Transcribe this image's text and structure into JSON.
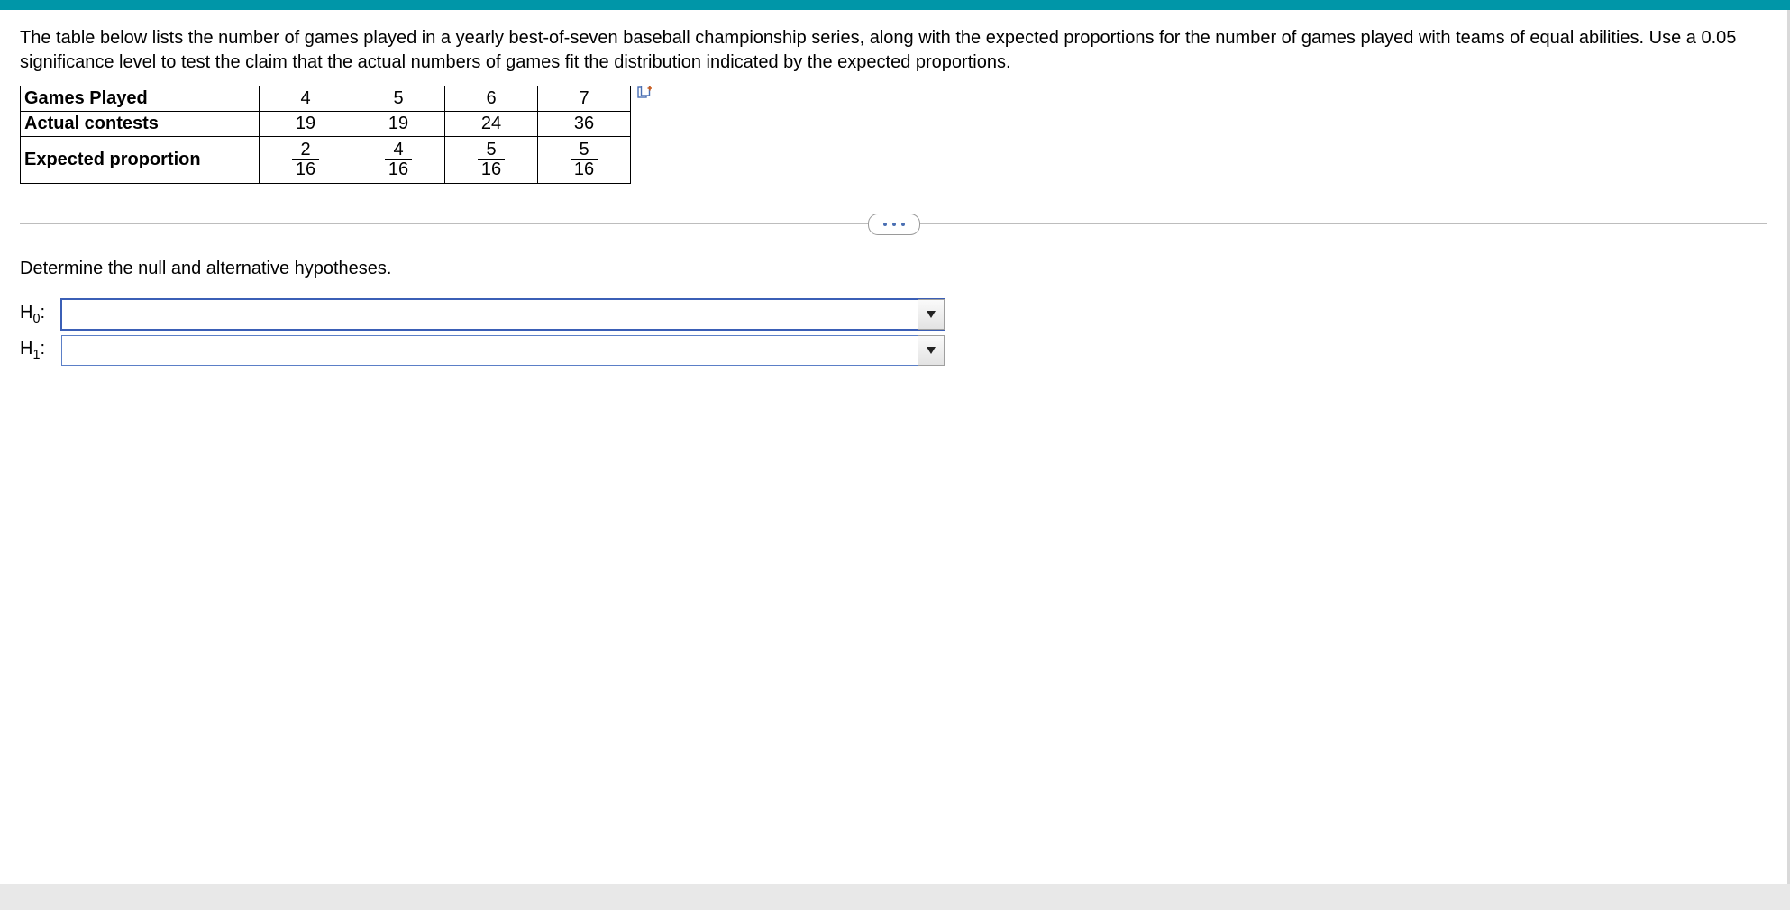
{
  "problem": {
    "text": "The table below lists the number of games played in a yearly best-of-seven baseball championship series, along with the expected proportions for the number of games played with teams of equal abilities. Use a 0.05 significance level to test the claim that the actual numbers of games fit the distribution indicated by the expected proportions."
  },
  "table": {
    "rows": [
      {
        "label": "Games Played",
        "values": [
          "4",
          "5",
          "6",
          "7"
        ]
      },
      {
        "label": "Actual contests",
        "values": [
          "19",
          "19",
          "24",
          "36"
        ]
      }
    ],
    "expected_row_label": "Expected proportion",
    "expected_fractions": [
      {
        "num": "2",
        "den": "16"
      },
      {
        "num": "4",
        "den": "16"
      },
      {
        "num": "5",
        "den": "16"
      },
      {
        "num": "5",
        "den": "16"
      }
    ]
  },
  "chart_data": {
    "type": "table",
    "columns": [
      "Games Played",
      "Actual contests",
      "Expected proportion"
    ],
    "rows": [
      {
        "Games Played": 4,
        "Actual contests": 19,
        "Expected proportion": "2/16"
      },
      {
        "Games Played": 5,
        "Actual contests": 19,
        "Expected proportion": "4/16"
      },
      {
        "Games Played": 6,
        "Actual contests": 24,
        "Expected proportion": "5/16"
      },
      {
        "Games Played": 7,
        "Actual contests": 36,
        "Expected proportion": "5/16"
      }
    ]
  },
  "subprompt": "Determine the null and alternative hypotheses.",
  "hypotheses": {
    "h0_label": "H",
    "h0_sub": "0",
    "h0_colon": ":",
    "h1_label": "H",
    "h1_sub": "1",
    "h1_colon": ":",
    "h0_value": "",
    "h1_value": ""
  }
}
